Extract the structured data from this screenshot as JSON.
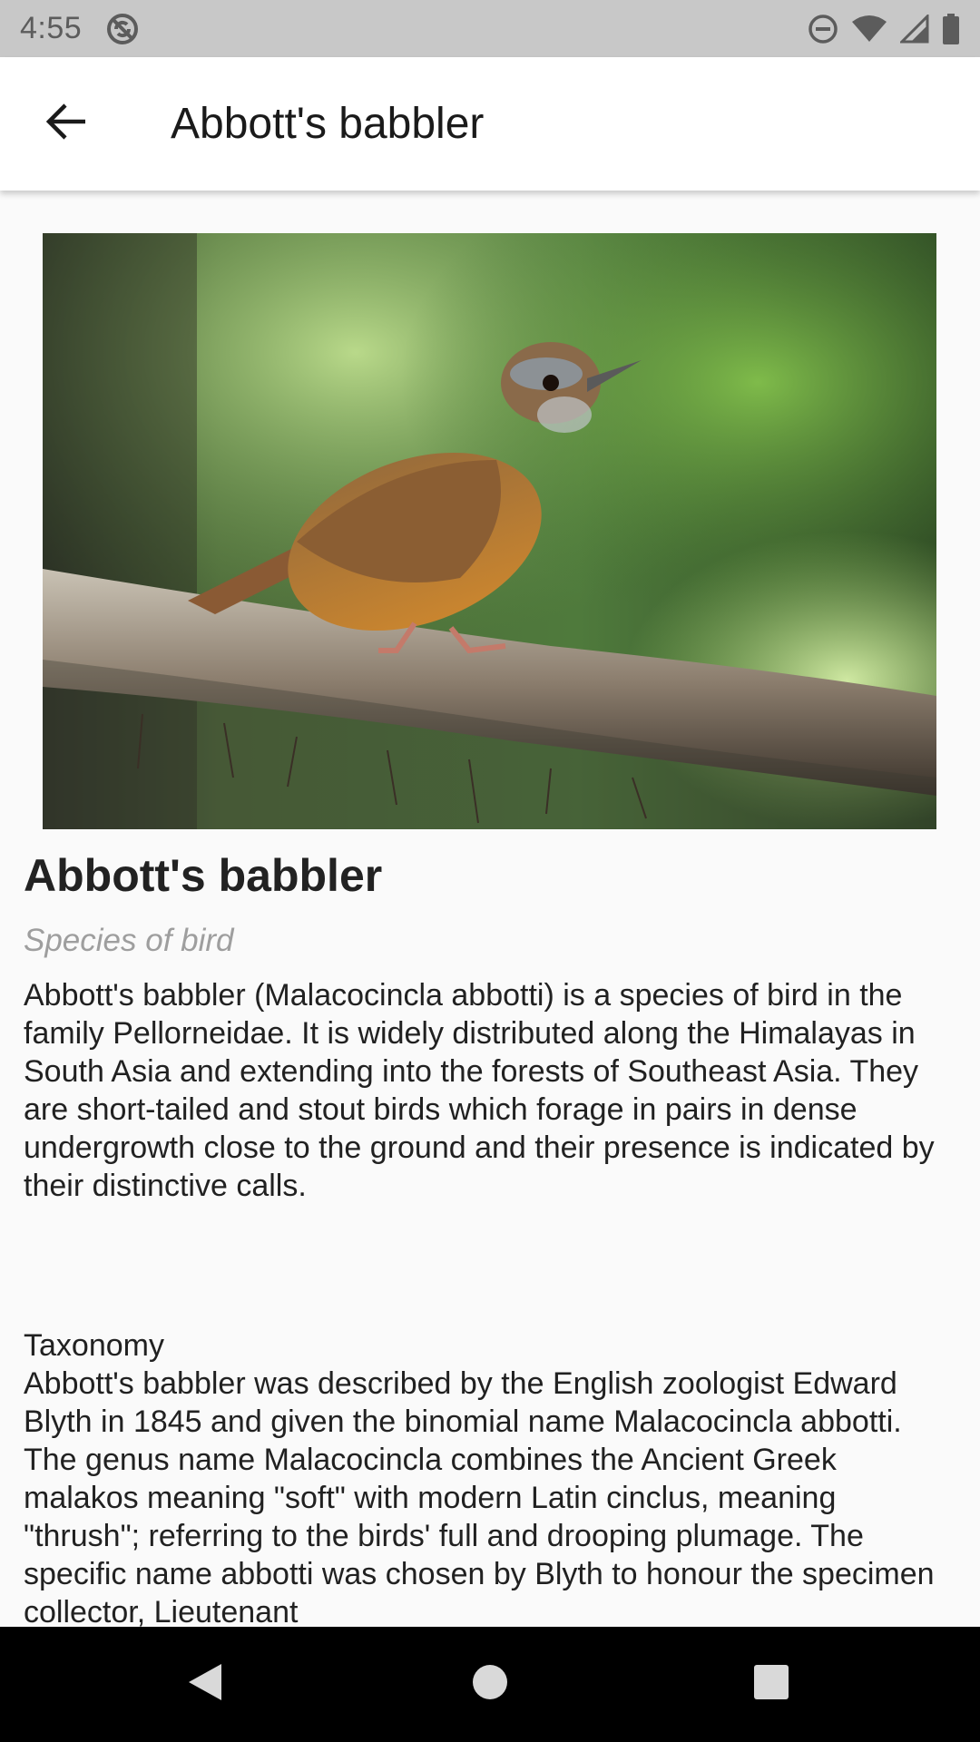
{
  "status_bar": {
    "time": "4:55",
    "icons": [
      "sync-disabled-icon",
      "do-not-disturb-icon",
      "wifi-icon",
      "cell-signal-icon",
      "battery-icon"
    ]
  },
  "app_bar": {
    "back_icon": "arrow-back-icon",
    "title": "Abbott's babbler"
  },
  "article": {
    "image_alt": "Abbott's babbler perched on a thorny branch",
    "title": "Abbott's babbler",
    "subtitle": "Species of bird",
    "summary": "Abbott's babbler (Malacocincla abbotti) is a species of bird in the family Pellorneidae. It is widely distributed along the Himalayas in South Asia and extending into the forests of Southeast Asia. They are short-tailed and stout birds which forage in pairs in dense undergrowth close to the ground and their presence is indicated by their distinctive calls.",
    "section_title": "Taxonomy",
    "section_body": "Abbott's babbler was described by the English zoologist Edward Blyth in 1845 and given the binomial name Malacocincla abbotti. The genus name Malacocincla combines the Ancient Greek malakos meaning \"soft\" with modern Latin cinclus, meaning \"thrush\"; referring to the birds' full and drooping plumage. The specific name abbotti was chosen by Blyth to honour the specimen collector, Lieutenant"
  },
  "nav_bar": {
    "buttons": [
      "back-triangle-icon",
      "home-circle-icon",
      "recents-square-icon"
    ]
  },
  "colors": {
    "status_bar_bg": "#c8c8c8",
    "app_bar_bg": "#ffffff",
    "page_bg": "#fafafa",
    "subtitle": "#9e9e9e",
    "nav_bar_bg": "#000000"
  }
}
